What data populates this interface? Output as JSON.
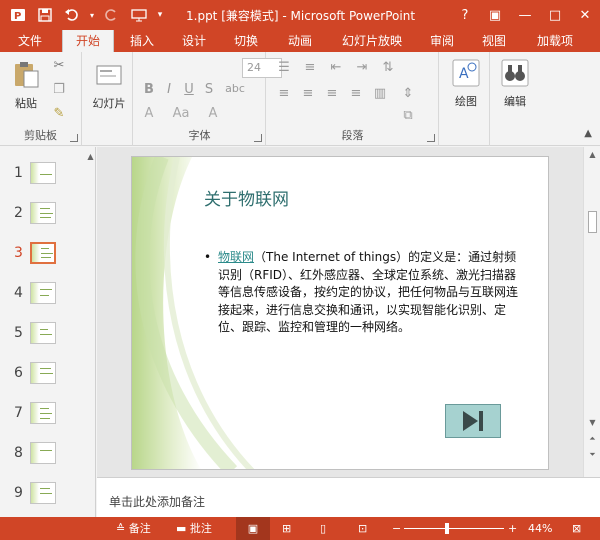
{
  "window": {
    "title": "1.ppt [兼容模式] - Microsoft PowerPoint",
    "help": "?",
    "controls": {
      "restore_ribbon": "▣",
      "minimize": "—",
      "maximize": "□",
      "close": "✕"
    }
  },
  "qat": [
    "save-icon",
    "undo-icon",
    "redo-icon",
    "slideshow-icon"
  ],
  "tabs": [
    "文件",
    "开始",
    "插入",
    "设计",
    "切换",
    "动画",
    "幻灯片放映",
    "审阅",
    "视图",
    "加载项"
  ],
  "active_tab": "开始",
  "ribbon": {
    "clipboard": {
      "paste": "粘贴",
      "label": "剪贴板"
    },
    "slides": {
      "new_slide": "幻灯片",
      "label": ""
    },
    "font": {
      "size": "24",
      "label": "字体"
    },
    "paragraph": {
      "label": "段落"
    },
    "drawing": {
      "label": "绘图"
    },
    "editing": {
      "label": "编辑"
    }
  },
  "thumbnails": [
    "1",
    "2",
    "3",
    "4",
    "5",
    "6",
    "7",
    "8",
    "9"
  ],
  "selected_thumbnail": "3",
  "slide": {
    "title": "关于物联网",
    "bullet_link": "物联网",
    "bullet_text": "（The Internet of things）的定义是：通过射频识别（RFID）、红外感应器、全球定位系统、激光扫描器等信息传感设备，按约定的协议，把任何物品与互联网连接起来，进行信息交换和通讯，以实现智能化识别、定位、跟踪、监控和管理的一种网络。"
  },
  "notes_placeholder": "单击此处添加备注",
  "statusbar": {
    "notes": "备注",
    "comments": "批注",
    "zoom": "44%",
    "zoom_minus": "−",
    "zoom_plus": "+"
  },
  "colors": {
    "accent": "#d04526",
    "title_teal": "#2e6e6e",
    "link_teal": "#2b8a8a",
    "nav_button": "#a6d2d0"
  }
}
